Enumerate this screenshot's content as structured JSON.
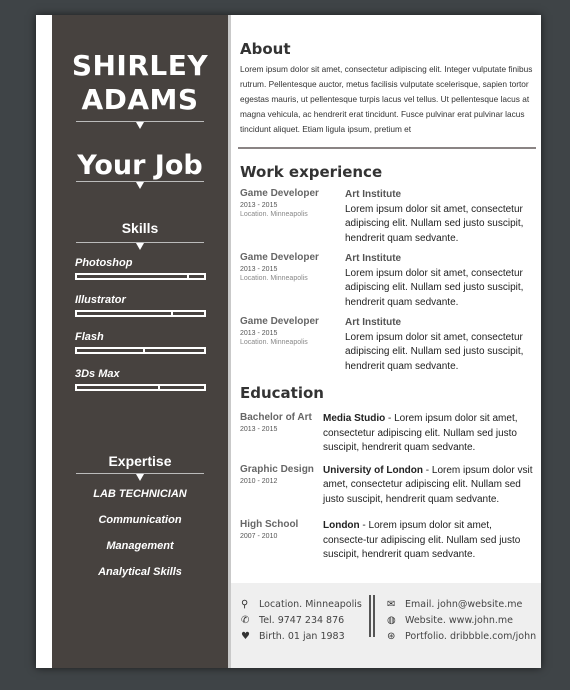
{
  "sidebar": {
    "first_name": "SHIRLEY",
    "last_name": "ADAMS",
    "job": "Your Job",
    "skills_title": "Skills",
    "skills": [
      {
        "label": "Photoshop",
        "level": 0.87
      },
      {
        "label": "Illustrator",
        "level": 0.74
      },
      {
        "label": "Flash",
        "level": 0.52
      },
      {
        "label": "3Ds Max",
        "level": 0.64
      }
    ],
    "expertise_title": "Expertise",
    "expertise": [
      "LAB TECHNICIAN",
      "Communication",
      "Management",
      "Analytical Skills"
    ]
  },
  "about": {
    "title": "About",
    "text": "Lorem ipsum dolor sit amet, consectetur adipiscing elit. Integer vulputate finibus rutrum. Pellentesque auctor, metus facilisis vulputate scelerisque, sapien tortor egestas mauris, ut pellentesque turpis lacus vel tellus. Ut pellentesque lacus at magna vehicula, ac hendrerit erat tincidunt. Fusce pulvinar erat pulvinar lacus tincidunt aliquet. Etiam ligula ipsum, pretium et"
  },
  "work": {
    "title": "Work experience",
    "items": [
      {
        "role": "Game Developer",
        "years": "2013 - 2015",
        "location": "Location. Minneapolis",
        "org": "Art Institute",
        "text": "Lorem ipsum dolor sit amet, consectetur adipiscing elit. Nullam sed justo suscipit, hendrerit quam sedvante."
      },
      {
        "role": "Game Developer",
        "years": "2013 - 2015",
        "location": "Location. Minneapolis",
        "org": "Art Institute",
        "text": "Lorem ipsum dolor sit amet, consectetur adipiscing elit. Nullam sed justo suscipit, hendrerit quam sedvante."
      },
      {
        "role": "Game Developer",
        "years": "2013 - 2015",
        "location": "Location. Minneapolis",
        "org": "Art Institute",
        "text": "Lorem ipsum dolor sit amet, consectetur adipiscing elit. Nullam sed justo suscipit, hendrerit quam sedvante."
      }
    ]
  },
  "education": {
    "title": "Education",
    "items": [
      {
        "degree": "Bachelor of Art",
        "years": "2013 - 2015",
        "school": "Media Studio",
        "text": " - Lorem ipsum dolor sit amet, consectetur adipiscing elit. Nullam sed justo suscipit, hendrerit quam sedvante."
      },
      {
        "degree": "Graphic Design",
        "years": "2010 - 2012",
        "school": "University of London",
        "text": " - Lorem ipsum dolor vsit amet, consectetur adipiscing elit. Nullam sed justo suscipit, hendrerit quam sedvante."
      },
      {
        "degree": "High School",
        "years": "2007 - 2010",
        "school": "London",
        "text": " - Lorem ipsum dolor sit amet, consecte-tur adipiscing elit. Nullam sed justo suscipit, hendrerit quam sedvante."
      }
    ]
  },
  "contact": {
    "location": "Location. Minneapolis",
    "tel": "Tel. 9747 234 876",
    "birth": "Birth. 01 jan 1983",
    "email": "Email. john@website.me",
    "website": "Website. www.john.me",
    "portfolio": "Portfolio. dribbble.com/john"
  }
}
